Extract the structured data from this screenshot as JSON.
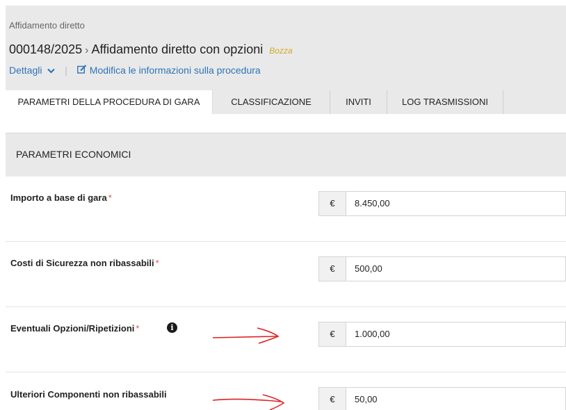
{
  "header": {
    "breadcrumb": "Affidamento diretto",
    "procedure_number": "000148/2025",
    "separator": "›",
    "procedure_title": "Affidamento diretto con opzioni",
    "status": "Bozza",
    "details_link": "Dettagli",
    "edit_link": "Modifica le informazioni sulla procedura"
  },
  "tabs": [
    {
      "label": "PARAMETRI DELLA PROCEDURA DI GARA",
      "active": true
    },
    {
      "label": "CLASSIFICAZIONE",
      "active": false
    },
    {
      "label": "INVITI",
      "active": false
    },
    {
      "label": "LOG TRASMISSIONI",
      "active": false
    }
  ],
  "section": {
    "title": "PARAMETRI ECONOMICI"
  },
  "fields": [
    {
      "label": "Importo a base di gara",
      "required": "*",
      "currency": "€",
      "value": "8.450,00"
    },
    {
      "label": "Costi di Sicurezza non ribassabili",
      "required": "*",
      "currency": "€",
      "value": "500,00"
    },
    {
      "label": "Eventuali Opzioni/Ripetizioni",
      "required": "*",
      "currency": "€",
      "value": "1.000,00",
      "info_icon": "info-circle-icon"
    },
    {
      "label": "Ulteriori Componenti non ribassabili",
      "required": "",
      "currency": "€",
      "value": "50,00"
    }
  ],
  "colors": {
    "accent": "#2d74b8",
    "status": "#d4a82a",
    "required": "#d9534f",
    "annotation": "#e02020"
  }
}
